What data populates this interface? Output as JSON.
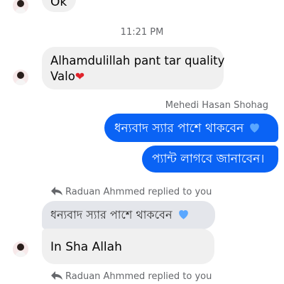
{
  "top_partial": {
    "text": "Ok"
  },
  "timestamp": "11:21 PM",
  "messages": [
    {
      "line1": "Alhamdulillah pant tar quality",
      "line2": "Valo",
      "emoji": "❤"
    }
  ],
  "sender_label": "Mehedi Hasan Shohag",
  "outgoing": [
    {
      "text": "ধন্যবাদ স্যার পাশে থাকবেন",
      "emoji": "blue-heart"
    },
    {
      "text": "প্যান্ট লাগবে জানাবেন।"
    }
  ],
  "reply_1": {
    "label": "Raduan Ahmmed replied to you",
    "quote": "ধন্যবাদ স্যার পাশে থাকবেন",
    "quote_emoji": "blue-heart",
    "message": "In Sha Allah"
  },
  "reply_2": {
    "label": "Raduan Ahmmed replied to you"
  },
  "colors": {
    "outgoing_bubble": "#0a63f5",
    "incoming_bubble": "#f0f0f0",
    "quoted_bubble": "#e4e6eb",
    "meta_text": "#65676b",
    "heart_red": "#e0242c",
    "heart_blue": "#5aa7ff"
  }
}
